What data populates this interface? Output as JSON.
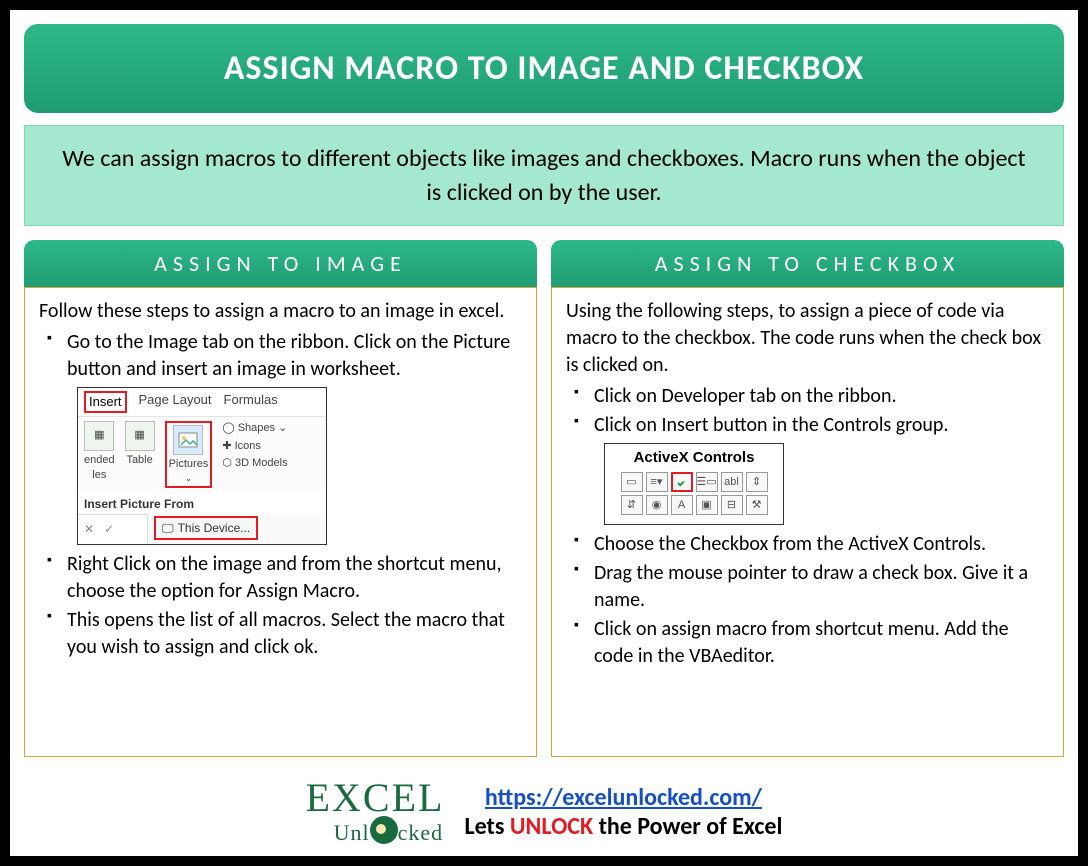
{
  "title": "ASSIGN MACRO TO IMAGE AND CHECKBOX",
  "intro": "We can assign macros to different objects like images and checkboxes. Macro runs when the object is clicked on by the user.",
  "left": {
    "header": "ASSIGN TO IMAGE",
    "lead": "Follow these steps to assign a macro to an image in excel.",
    "step1": "Go to the Image tab on the ribbon. Click on the Picture button and insert an image in worksheet.",
    "step2": "Right Click on the image and from the shortcut menu, choose the option for Assign Macro.",
    "step3": "This opens the list of all macros. Select the macro that you wish to assign and click ok.",
    "ribbon": {
      "tab_insert": "Insert",
      "tab_pagelayout": "Page Layout",
      "tab_formulas": "Formulas",
      "btn_ended": "ended",
      "btn_les": "les",
      "btn_table": "Table",
      "btn_pictures": "Pictures",
      "shapes": "Shapes",
      "icons": "Icons",
      "models": "3D Models",
      "insert_from": "Insert Picture From",
      "this_device": "This Device..."
    }
  },
  "right": {
    "header": "ASSIGN TO CHECKBOX",
    "lead": "Using the following steps, to assign a piece of code via macro to the checkbox. The code runs when the check box is clicked on.",
    "s1": "Click on Developer tab on the ribbon.",
    "s2": "Click on Insert button in the Controls group.",
    "s3": "Choose the Checkbox from the ActiveX Controls.",
    "s4": "Drag the mouse pointer to draw a check box. Give it a name.",
    "s5": "Click on assign macro from shortcut menu. Add the code in the VBAeditor.",
    "activex_title": "ActiveX Controls",
    "abl": "abl"
  },
  "footer": {
    "url": "https://excelunlocked.com/",
    "tagline_pre": "Lets ",
    "tagline_unlock": "UNLOCK",
    "tagline_post": " the Power of Excel",
    "logo_big": "EXCEL",
    "logo_small_pre": "Unl",
    "logo_small_post": "cked"
  }
}
